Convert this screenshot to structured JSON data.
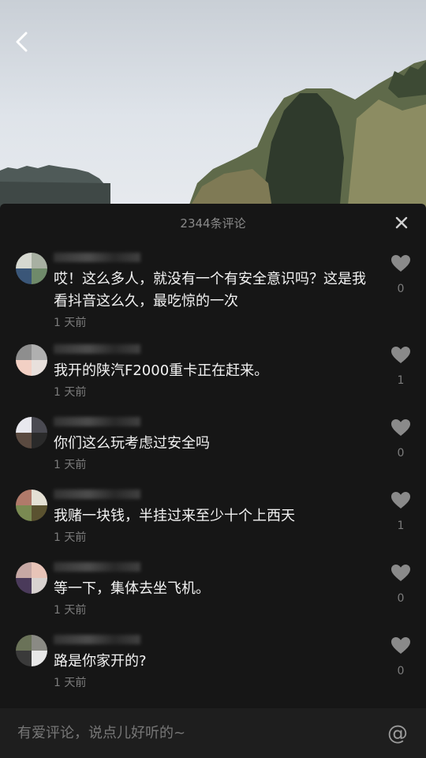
{
  "header": {
    "comment_count_label": "2344条评论"
  },
  "icons": {
    "back": "chevron-left-icon",
    "close": "close-icon",
    "like": "heart-icon",
    "mention": "at-icon"
  },
  "comments": [
    {
      "text": "哎！这么多人，就没有一个有安全意识吗？这是我看抖音这么久，最吃惊的一次",
      "time": "1 天前",
      "likes": "0"
    },
    {
      "text": "我开的陕汽F2000重卡正在赶来。",
      "time": "1 天前",
      "likes": "1"
    },
    {
      "text": "你们这么玩考虑过安全吗",
      "time": "1 天前",
      "likes": "0"
    },
    {
      "text": "我赌一块钱，半挂过来至少十个上西天",
      "time": "1 天前",
      "likes": "1"
    },
    {
      "text": "等一下，集体去坐飞机。",
      "time": "1 天前",
      "likes": "0"
    },
    {
      "text": "路是你家开的?",
      "time": "1 天前",
      "likes": "0"
    }
  ],
  "input": {
    "placeholder": "有爱评论，说点儿好听的~",
    "value": "",
    "at_symbol": "@"
  }
}
